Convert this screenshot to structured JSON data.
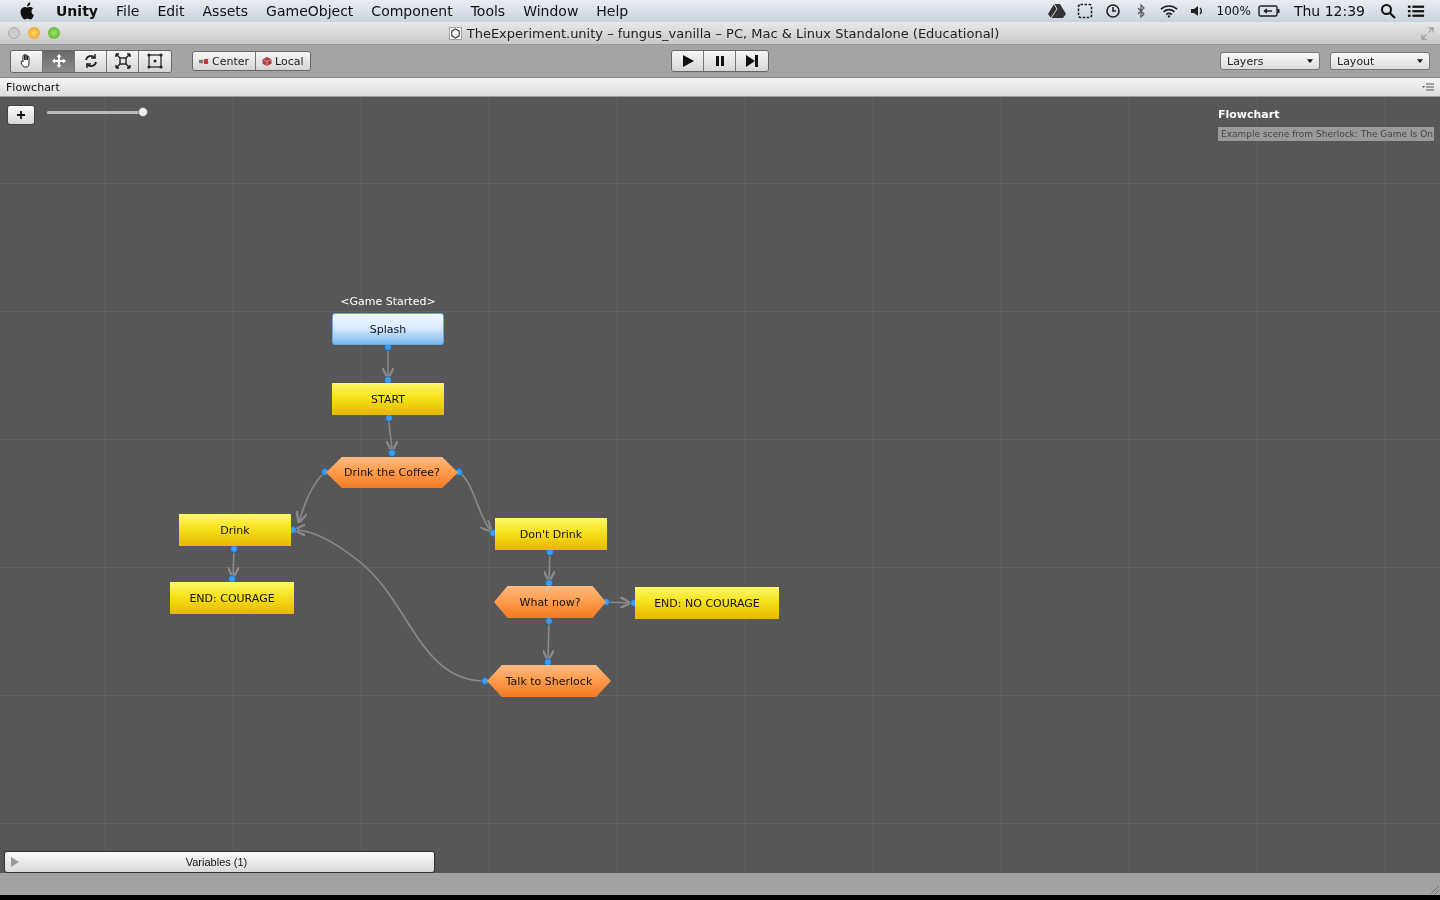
{
  "menu_bar": {
    "app": "Unity",
    "items": [
      "File",
      "Edit",
      "Assets",
      "GameObject",
      "Component",
      "Tools",
      "Window",
      "Help"
    ],
    "battery": "100%",
    "clock": "Thu 12:39"
  },
  "window": {
    "title": "TheExperiment.unity – fungus_vanilla – PC, Mac & Linux Standalone (Educational)"
  },
  "toolbar": {
    "tools": [
      {
        "selected": false
      },
      {
        "selected": true
      },
      {
        "selected": false
      },
      {
        "selected": false
      },
      {
        "selected": false
      }
    ],
    "pivot_buttons": [
      "Center",
      "Local"
    ],
    "dropdowns": [
      "Layers",
      "Layout"
    ]
  },
  "panel": {
    "tab": "Flowchart"
  },
  "zoom": {
    "level": 1
  },
  "flowchart": {
    "name": "Flowchart",
    "description": "Example scene from Sherlock: The Game Is On"
  },
  "nodes": [
    {
      "kind": "event",
      "label": "Splash",
      "event": "<Game Started>"
    },
    {
      "kind": "block",
      "label": "START"
    },
    {
      "kind": "choice",
      "label": "Drink the Coffee?"
    },
    {
      "kind": "block",
      "label": "Drink"
    },
    {
      "kind": "block",
      "label": "Don't Drink"
    },
    {
      "kind": "block",
      "label": "END: COURAGE"
    },
    {
      "kind": "choice",
      "label": "What now?"
    },
    {
      "kind": "block",
      "label": "END: NO COURAGE"
    },
    {
      "kind": "choice",
      "label": "Talk to Sherlock"
    }
  ],
  "variables": {
    "label": "Variables (1)",
    "expanded": false
  }
}
